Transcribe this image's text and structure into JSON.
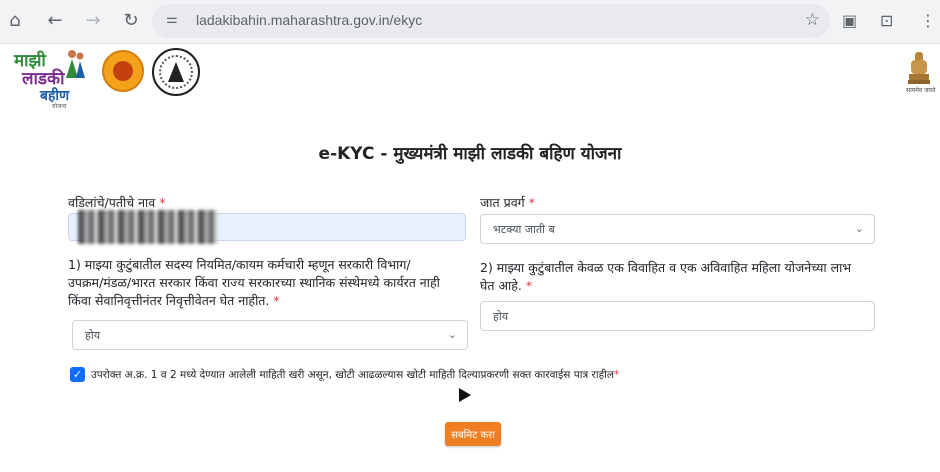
{
  "browser": {
    "url": "ladakibahin.maharashtra.gov.in/ekyc"
  },
  "header": {
    "logo_line1": "माझी",
    "logo_line2": "लाडकी",
    "logo_line3": "बहीण",
    "logo_line4": "योजना",
    "emblem_caption": "सत्यमेव जयते"
  },
  "page": {
    "title": "e-KYC - मुख्यमंत्री माझी लाडकी बहिण योजना"
  },
  "form": {
    "father_name": {
      "label": "वडिलांचे/पतीचे नाव",
      "required": "*",
      "value": ""
    },
    "caste_category": {
      "label": "जात प्रवर्ग",
      "required": "*",
      "selected": "भटक्या जाती ब"
    },
    "question1": {
      "line1": "1) माझ्या कुटुंबातील सदस्य नियमित/कायम कर्मचारी म्हणून सरकारी विभाग/",
      "line2": "उपक्रम/मंडळ/भारत सरकार किंवा राज्य सरकारच्या स्थानिक संस्थेमध्ये कार्यरत नाही",
      "line3": "किंवा सेवानिवृत्तीनंतर निवृत्तीवेतन घेत नाहीत.",
      "required": "*",
      "selected": "होय"
    },
    "question2": {
      "line1": "2) माझ्या कुटुंबातील केवळ एक विवाहित व एक अविवाहित महिला योजनेच्या लाभ",
      "line2": "घेत आहे.",
      "required": "*",
      "value": "होय"
    },
    "declaration": {
      "checked": true,
      "text": "उपरोक्त अ.क्र. 1 व 2 मध्ये देण्यात आलेली माहिती खरी असून, खोटी आढळल्यास खोटी माहिती दिल्याप्रकरणी सक्त कारवाईस पात्र राहील",
      "required": "*"
    },
    "submit_label": "सबमिट करा"
  },
  "colors": {
    "accent": "#f07e22",
    "checkbox": "#0d6efd",
    "required": "#dc3545"
  }
}
